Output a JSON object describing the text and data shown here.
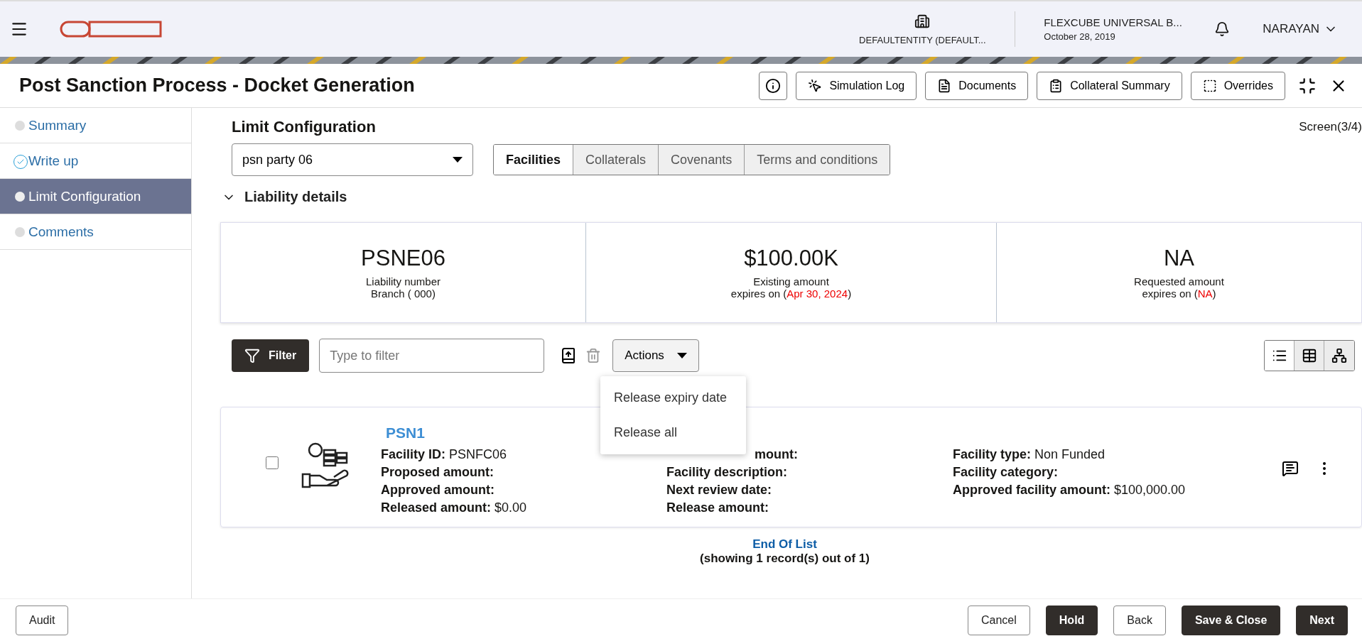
{
  "header": {
    "entity": "DEFAULTENTITY (DEFAULT...",
    "product": "FLEXCUBE UNIVERSAL B...",
    "date": "October 28, 2019",
    "user": "NARAYAN"
  },
  "title": "Post Sanction Process - Docket Generation",
  "toolbar_buttons": [
    {
      "label": "Simulation Log",
      "kind": "simulation"
    },
    {
      "label": "Documents",
      "kind": "documents"
    },
    {
      "label": "Collateral Summary",
      "kind": "summary"
    },
    {
      "label": "Overrides",
      "kind": "overrides"
    }
  ],
  "steps": [
    {
      "label": "Summary",
      "done": false,
      "selected": false
    },
    {
      "label": "Write up",
      "done": true,
      "selected": false
    },
    {
      "label": "Limit Configuration",
      "done": false,
      "selected": true
    },
    {
      "label": "Comments",
      "done": false,
      "selected": false
    }
  ],
  "section_title": "Limit Configuration",
  "screen": "Screen(3/4)",
  "party": {
    "value": "psn party 06"
  },
  "tabs": [
    {
      "label": "Facilities",
      "selected": true
    },
    {
      "label": "Collaterals",
      "selected": false
    },
    {
      "label": "Covenants",
      "selected": false
    },
    {
      "label": "Terms and conditions",
      "selected": false
    }
  ],
  "liability": {
    "title": "Liability details",
    "expanded": true,
    "cards": [
      {
        "value": "PSNE06",
        "lines": [
          "Liability number",
          "Branch ( 000)"
        ]
      },
      {
        "value": "$100.00K",
        "lines": [
          "Existing amount"
        ],
        "expires_label": "expires on (",
        "expires_value": "Apr 30, 2024",
        "expires_end": ")"
      },
      {
        "value": "NA",
        "lines": [
          "Requested amount"
        ],
        "expires_label": "expires on (",
        "expires_value": "NA",
        "expires_end": ")"
      }
    ]
  },
  "filter": {
    "button": "Filter",
    "placeholder": "Type to filter",
    "actions": "Actions",
    "menu": [
      "Release expiry date",
      "Release all"
    ]
  },
  "views": [
    {
      "kind": "list",
      "selected": true
    },
    {
      "kind": "table",
      "selected": false
    },
    {
      "kind": "tree",
      "selected": false
    }
  ],
  "facilities": [
    {
      "name": "PSN1",
      "checked": false,
      "columns": [
        [
          {
            "label": "Facility ID:",
            "value": "PSNFC06"
          },
          {
            "label": "Proposed amount:"
          },
          {
            "label": "Approved amount:"
          },
          {
            "label": "Released amount:",
            "value": "$0.00"
          }
        ],
        [
          {
            "label": "mount:",
            "kind": "partly_covered"
          },
          {
            "label": "Facility description:"
          },
          {
            "label": "Next review date:"
          },
          {
            "label": "Release amount:"
          }
        ],
        [
          {
            "label": "Facility type:",
            "value": "Non Funded"
          },
          {
            "label": "Facility category:"
          },
          {
            "label": "Approved facility amount:",
            "value": "$100,000.00"
          }
        ]
      ]
    }
  ],
  "end_of_list": "End Of List",
  "record_count": "(showing 1 record(s) out of 1)",
  "footer": {
    "left": [
      {
        "label": "Audit",
        "primary": false
      }
    ],
    "right": [
      {
        "label": "Cancel",
        "primary": false
      },
      {
        "label": "Hold",
        "primary": true
      },
      {
        "label": "Back",
        "primary": false
      },
      {
        "label": "Save & Close",
        "primary": true
      },
      {
        "label": "Next",
        "primary": true
      }
    ]
  }
}
